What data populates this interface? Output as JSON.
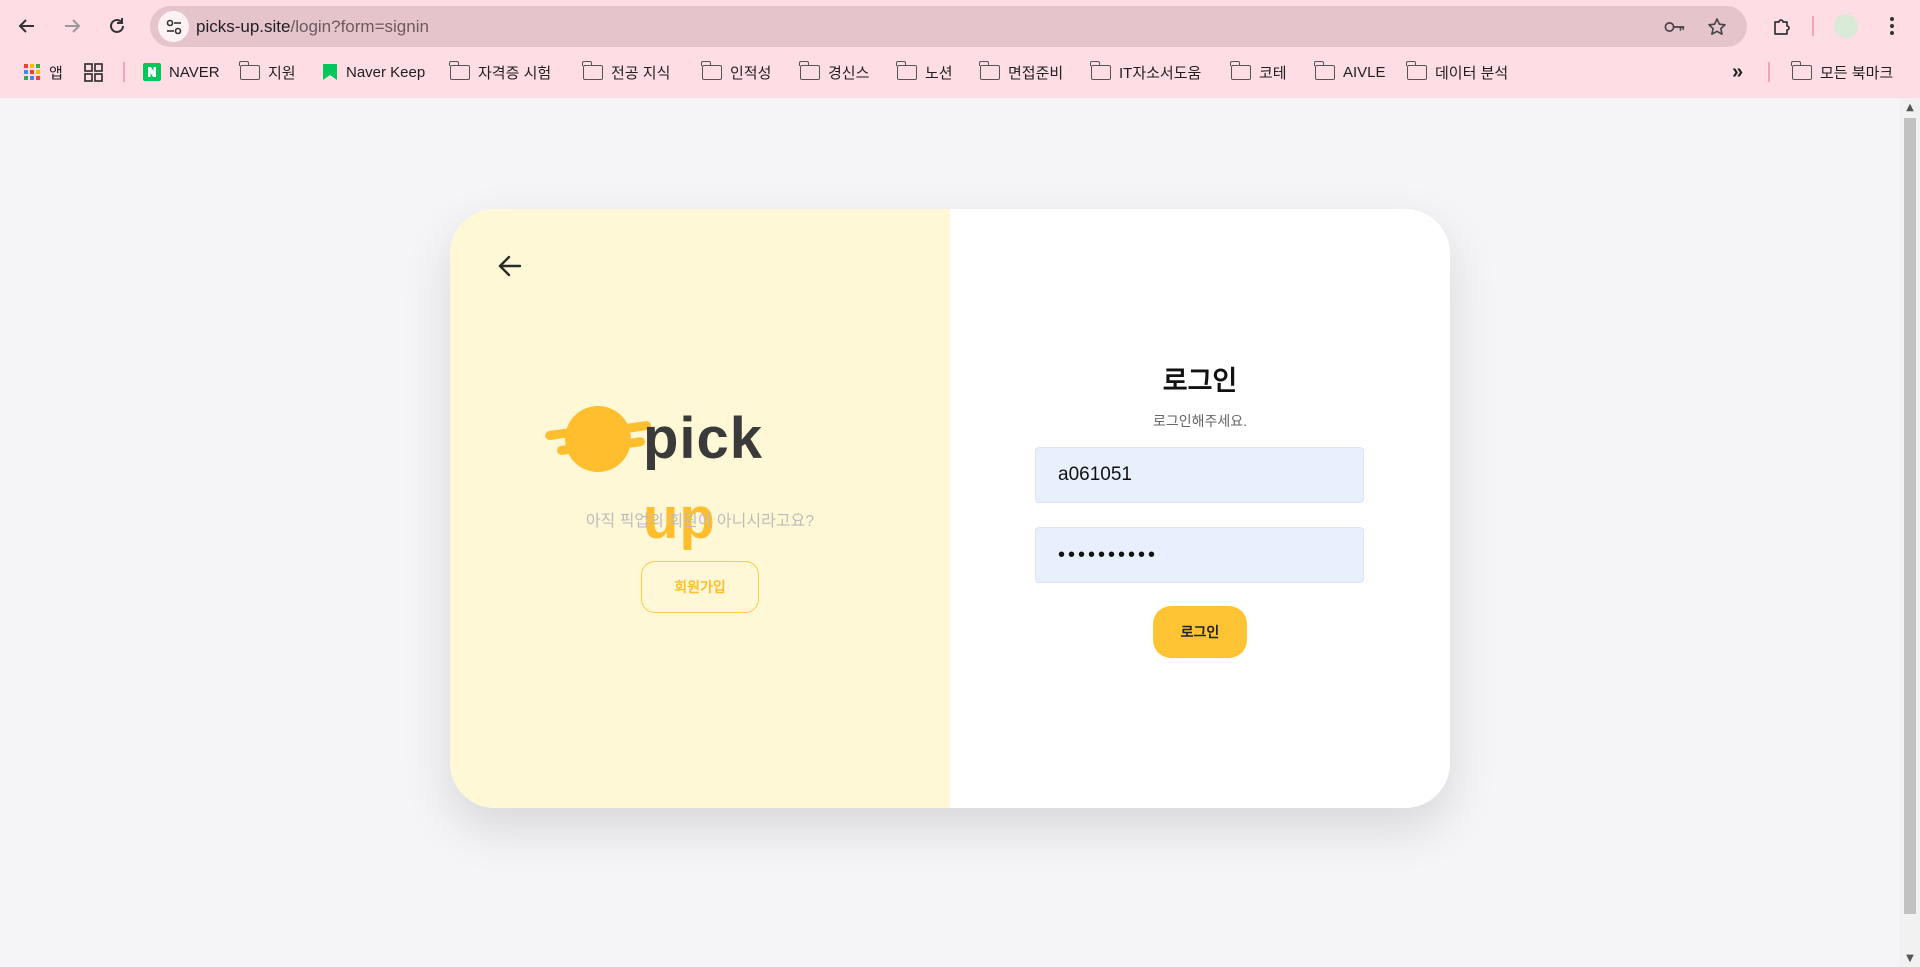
{
  "browser": {
    "url_host": "picks-up.site",
    "url_path": "/login?form=signin",
    "bookmarks": [
      {
        "label": "앱",
        "icon": "apps-grid-icon"
      },
      {
        "label": "",
        "icon": "tab-groups-icon"
      },
      {
        "label": "NAVER",
        "icon": "naver-icon"
      },
      {
        "label": "지원",
        "icon": "folder-icon"
      },
      {
        "label": "Naver Keep",
        "icon": "keep-bookmark-icon"
      },
      {
        "label": "자격증 시험",
        "icon": "folder-icon"
      },
      {
        "label": "전공 지식",
        "icon": "folder-icon"
      },
      {
        "label": "인적성",
        "icon": "folder-icon"
      },
      {
        "label": "경신스",
        "icon": "folder-icon"
      },
      {
        "label": "노션",
        "icon": "folder-icon"
      },
      {
        "label": "면접준비",
        "icon": "folder-icon"
      },
      {
        "label": "IT자소서도움",
        "icon": "folder-icon"
      },
      {
        "label": "코테",
        "icon": "folder-icon"
      },
      {
        "label": "AIVLE",
        "icon": "folder-icon"
      },
      {
        "label": "데이터 분석",
        "icon": "folder-icon"
      }
    ],
    "more_label": "»",
    "all_bookmarks_label": "모든 북마크"
  },
  "left": {
    "logo_text_main": "pick ",
    "logo_text_accent": "up",
    "tagline": "아직 픽업의 회원이 아니시라고요?",
    "signup_label": "회원가입"
  },
  "login": {
    "title": "로그인",
    "subtitle": "로그인해주세요.",
    "id_value": "a061051",
    "password_mask": "••••••••••",
    "submit_label": "로그인"
  },
  "colors": {
    "chrome_bg": "#fedde5",
    "left_panel_bg": "#fff8d6",
    "accent": "#ffc434",
    "input_bg": "#e8f0fe"
  }
}
